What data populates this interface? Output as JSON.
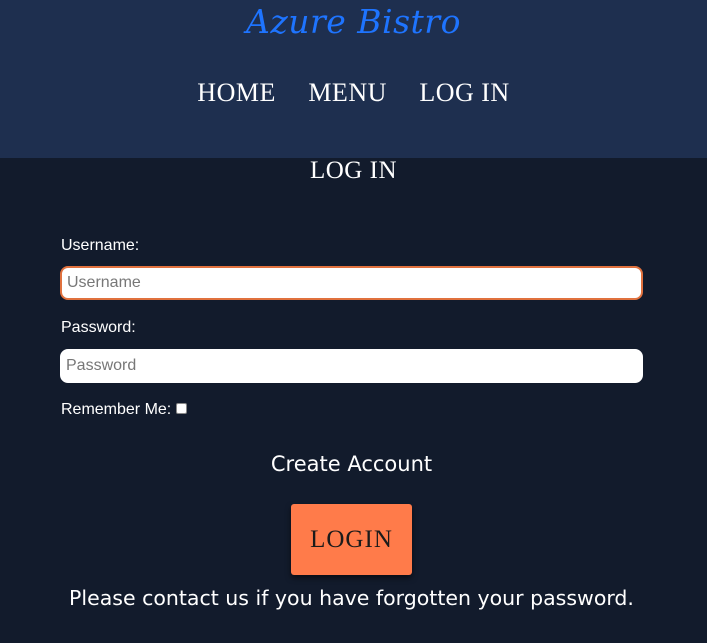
{
  "header": {
    "brand": "Azure Bistro",
    "nav": [
      "HOME",
      "MENU",
      "LOG IN"
    ]
  },
  "form": {
    "title": "LOG IN",
    "username_label": "Username:",
    "username_placeholder": "Username",
    "username_value": "",
    "password_label": "Password:",
    "password_placeholder": "Password",
    "password_value": "",
    "remember_label": "Remember Me:",
    "remember_checked": false,
    "create_account": "Create Account",
    "login_button": "LOGIN",
    "forgot_note": "Please contact us if you have forgotten your password."
  },
  "colors": {
    "header_bg": "#1e2f4f",
    "page_bg": "#121b2c",
    "brand": "#1e74ff",
    "button": "#ff7b4a",
    "focus_border": "#e0713e"
  }
}
